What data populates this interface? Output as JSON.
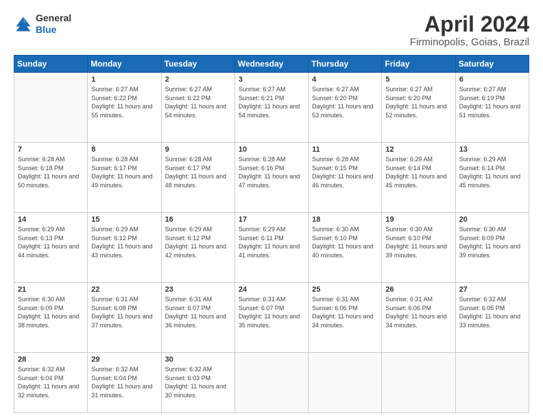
{
  "header": {
    "logo_line1": "General",
    "logo_line2": "Blue",
    "month": "April 2024",
    "location": "Firminopolis, Goias, Brazil"
  },
  "weekdays": [
    "Sunday",
    "Monday",
    "Tuesday",
    "Wednesday",
    "Thursday",
    "Friday",
    "Saturday"
  ],
  "weeks": [
    [
      {
        "day": "",
        "sunrise": "",
        "sunset": "",
        "daylight": ""
      },
      {
        "day": "1",
        "sunrise": "Sunrise: 6:27 AM",
        "sunset": "Sunset: 6:22 PM",
        "daylight": "Daylight: 11 hours and 55 minutes."
      },
      {
        "day": "2",
        "sunrise": "Sunrise: 6:27 AM",
        "sunset": "Sunset: 6:22 PM",
        "daylight": "Daylight: 11 hours and 54 minutes."
      },
      {
        "day": "3",
        "sunrise": "Sunrise: 6:27 AM",
        "sunset": "Sunset: 6:21 PM",
        "daylight": "Daylight: 11 hours and 54 minutes."
      },
      {
        "day": "4",
        "sunrise": "Sunrise: 6:27 AM",
        "sunset": "Sunset: 6:20 PM",
        "daylight": "Daylight: 11 hours and 53 minutes."
      },
      {
        "day": "5",
        "sunrise": "Sunrise: 6:27 AM",
        "sunset": "Sunset: 6:20 PM",
        "daylight": "Daylight: 11 hours and 52 minutes."
      },
      {
        "day": "6",
        "sunrise": "Sunrise: 6:27 AM",
        "sunset": "Sunset: 6:19 PM",
        "daylight": "Daylight: 11 hours and 51 minutes."
      }
    ],
    [
      {
        "day": "7",
        "sunrise": "Sunrise: 6:28 AM",
        "sunset": "Sunset: 6:18 PM",
        "daylight": "Daylight: 11 hours and 50 minutes."
      },
      {
        "day": "8",
        "sunrise": "Sunrise: 6:28 AM",
        "sunset": "Sunset: 6:17 PM",
        "daylight": "Daylight: 11 hours and 49 minutes."
      },
      {
        "day": "9",
        "sunrise": "Sunrise: 6:28 AM",
        "sunset": "Sunset: 6:17 PM",
        "daylight": "Daylight: 11 hours and 48 minutes."
      },
      {
        "day": "10",
        "sunrise": "Sunrise: 6:28 AM",
        "sunset": "Sunset: 6:16 PM",
        "daylight": "Daylight: 11 hours and 47 minutes."
      },
      {
        "day": "11",
        "sunrise": "Sunrise: 6:28 AM",
        "sunset": "Sunset: 6:15 PM",
        "daylight": "Daylight: 11 hours and 46 minutes."
      },
      {
        "day": "12",
        "sunrise": "Sunrise: 6:29 AM",
        "sunset": "Sunset: 6:14 PM",
        "daylight": "Daylight: 11 hours and 45 minutes."
      },
      {
        "day": "13",
        "sunrise": "Sunrise: 6:29 AM",
        "sunset": "Sunset: 6:14 PM",
        "daylight": "Daylight: 11 hours and 45 minutes."
      }
    ],
    [
      {
        "day": "14",
        "sunrise": "Sunrise: 6:29 AM",
        "sunset": "Sunset: 6:13 PM",
        "daylight": "Daylight: 11 hours and 44 minutes."
      },
      {
        "day": "15",
        "sunrise": "Sunrise: 6:29 AM",
        "sunset": "Sunset: 6:12 PM",
        "daylight": "Daylight: 11 hours and 43 minutes."
      },
      {
        "day": "16",
        "sunrise": "Sunrise: 6:29 AM",
        "sunset": "Sunset: 6:12 PM",
        "daylight": "Daylight: 11 hours and 42 minutes."
      },
      {
        "day": "17",
        "sunrise": "Sunrise: 6:29 AM",
        "sunset": "Sunset: 6:11 PM",
        "daylight": "Daylight: 11 hours and 41 minutes."
      },
      {
        "day": "18",
        "sunrise": "Sunrise: 6:30 AM",
        "sunset": "Sunset: 6:10 PM",
        "daylight": "Daylight: 11 hours and 40 minutes."
      },
      {
        "day": "19",
        "sunrise": "Sunrise: 6:30 AM",
        "sunset": "Sunset: 6:10 PM",
        "daylight": "Daylight: 11 hours and 39 minutes."
      },
      {
        "day": "20",
        "sunrise": "Sunrise: 6:30 AM",
        "sunset": "Sunset: 6:09 PM",
        "daylight": "Daylight: 11 hours and 39 minutes."
      }
    ],
    [
      {
        "day": "21",
        "sunrise": "Sunrise: 6:30 AM",
        "sunset": "Sunset: 6:09 PM",
        "daylight": "Daylight: 11 hours and 38 minutes."
      },
      {
        "day": "22",
        "sunrise": "Sunrise: 6:31 AM",
        "sunset": "Sunset: 6:08 PM",
        "daylight": "Daylight: 11 hours and 37 minutes."
      },
      {
        "day": "23",
        "sunrise": "Sunrise: 6:31 AM",
        "sunset": "Sunset: 6:07 PM",
        "daylight": "Daylight: 11 hours and 36 minutes."
      },
      {
        "day": "24",
        "sunrise": "Sunrise: 6:31 AM",
        "sunset": "Sunset: 6:07 PM",
        "daylight": "Daylight: 11 hours and 35 minutes."
      },
      {
        "day": "25",
        "sunrise": "Sunrise: 6:31 AM",
        "sunset": "Sunset: 6:06 PM",
        "daylight": "Daylight: 11 hours and 34 minutes."
      },
      {
        "day": "26",
        "sunrise": "Sunrise: 6:31 AM",
        "sunset": "Sunset: 6:06 PM",
        "daylight": "Daylight: 11 hours and 34 minutes."
      },
      {
        "day": "27",
        "sunrise": "Sunrise: 6:32 AM",
        "sunset": "Sunset: 6:05 PM",
        "daylight": "Daylight: 11 hours and 33 minutes."
      }
    ],
    [
      {
        "day": "28",
        "sunrise": "Sunrise: 6:32 AM",
        "sunset": "Sunset: 6:04 PM",
        "daylight": "Daylight: 11 hours and 32 minutes."
      },
      {
        "day": "29",
        "sunrise": "Sunrise: 6:32 AM",
        "sunset": "Sunset: 6:04 PM",
        "daylight": "Daylight: 11 hours and 31 minutes."
      },
      {
        "day": "30",
        "sunrise": "Sunrise: 6:32 AM",
        "sunset": "Sunset: 6:03 PM",
        "daylight": "Daylight: 11 hours and 30 minutes."
      },
      {
        "day": "",
        "sunrise": "",
        "sunset": "",
        "daylight": ""
      },
      {
        "day": "",
        "sunrise": "",
        "sunset": "",
        "daylight": ""
      },
      {
        "day": "",
        "sunrise": "",
        "sunset": "",
        "daylight": ""
      },
      {
        "day": "",
        "sunrise": "",
        "sunset": "",
        "daylight": ""
      }
    ]
  ]
}
